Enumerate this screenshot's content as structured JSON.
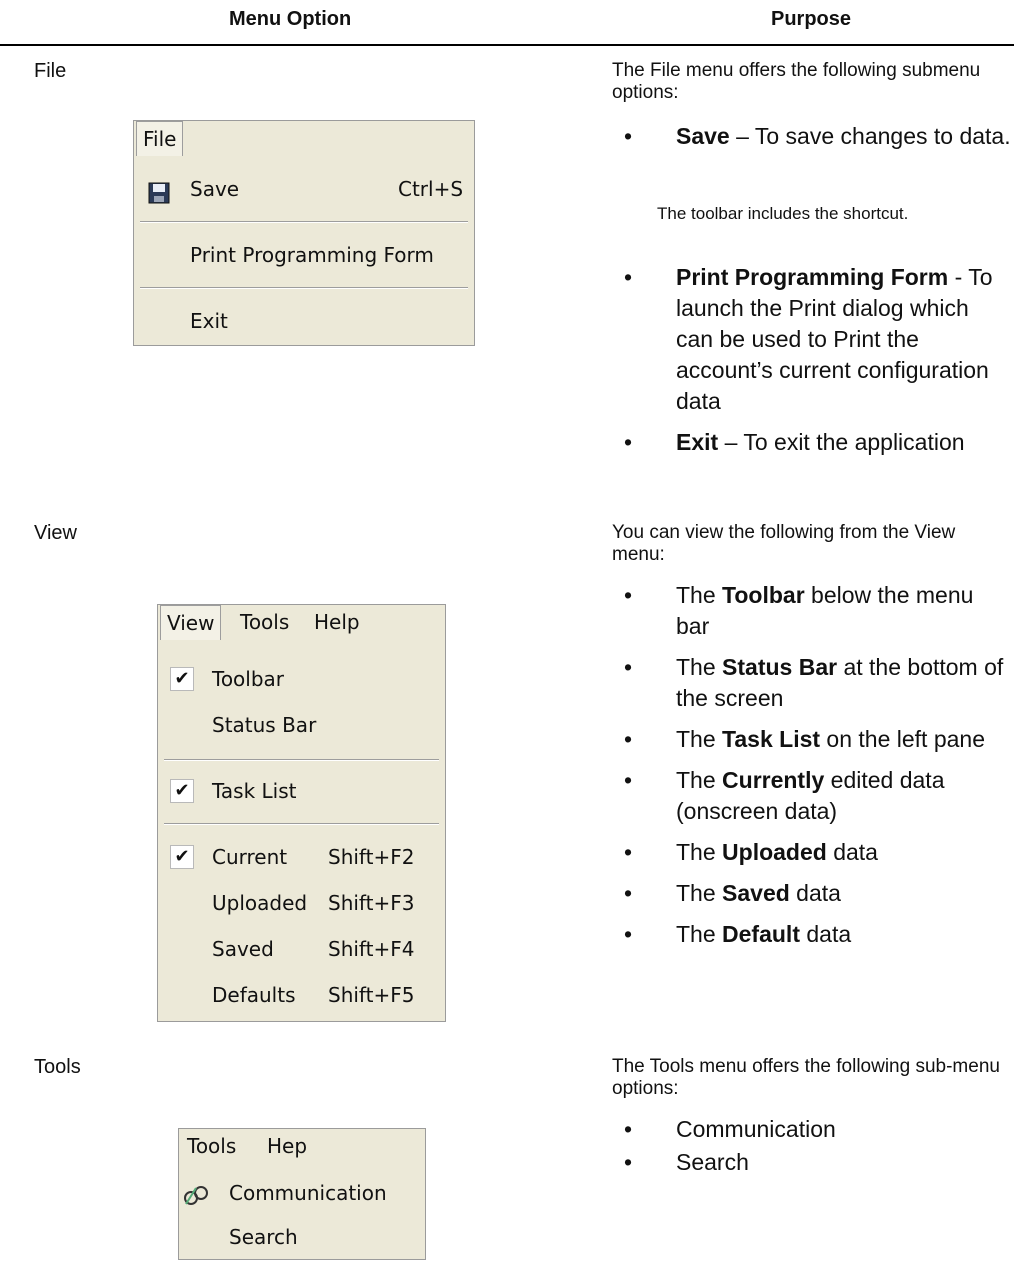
{
  "headers": {
    "col1": "Menu Option",
    "col2": "Purpose"
  },
  "rows": {
    "file": {
      "label": "File",
      "intro": "The File menu offers the following submenu options:",
      "menu": {
        "bar": [
          "File"
        ],
        "items": [
          {
            "label": "Save",
            "shortcut": "Ctrl+S",
            "icon": "floppy-disk-icon"
          },
          {
            "label": "Print Programming Form"
          },
          {
            "label": "Exit"
          }
        ]
      },
      "bullets": [
        {
          "bold": "Save",
          "text": " – To save changes to data."
        },
        {
          "bold": "Print Programming Form",
          "text": " - To launch the Print dialog which can be used to Print the account’s current configuration data"
        },
        {
          "bold": "Exit",
          "text": " – To exit the application"
        }
      ],
      "note": "The toolbar includes the shortcut."
    },
    "view": {
      "label": "View",
      "intro": "You can view the following from the View menu:",
      "menu": {
        "bar": [
          "View",
          "Tools",
          "Help"
        ],
        "items": [
          {
            "label": "Toolbar",
            "checked": true
          },
          {
            "label": "Status Bar"
          },
          {
            "label": "Task List",
            "checked": true
          },
          {
            "label": "Current",
            "shortcut": "Shift+F2",
            "checked": true
          },
          {
            "label": "Uploaded",
            "shortcut": "Shift+F3"
          },
          {
            "label": "Saved",
            "shortcut": "Shift+F4"
          },
          {
            "label": "Defaults",
            "shortcut": "Shift+F5"
          }
        ]
      },
      "bullets": [
        {
          "pre": "The ",
          "bold": "Toolbar",
          "text": " below the menu bar"
        },
        {
          "pre": "The ",
          "bold": "Status Bar",
          "text": " at the bottom of the screen"
        },
        {
          "pre": "The ",
          "bold": "Task List",
          "text": " on the left pane"
        },
        {
          "pre": "The ",
          "bold": "Currently",
          "text": " edited data (onscreen data)"
        },
        {
          "pre": "The ",
          "bold": "Uploaded",
          "text": " data"
        },
        {
          "pre": "The ",
          "bold": "Saved",
          "text": " data"
        },
        {
          "pre": "The ",
          "bold": "Default",
          "text": " data"
        }
      ]
    },
    "tools": {
      "label": "Tools",
      "intro": "The Tools menu offers the following sub-menu options:",
      "menu": {
        "bar": [
          "Tools",
          "Hep"
        ],
        "items": [
          {
            "label": "Communication",
            "icon": "communication-icon"
          },
          {
            "label": "Search"
          }
        ]
      },
      "bullets": [
        {
          "text": "Communication"
        },
        {
          "text": "Search"
        }
      ]
    }
  },
  "bullet_char": "•",
  "check_char": "✔"
}
